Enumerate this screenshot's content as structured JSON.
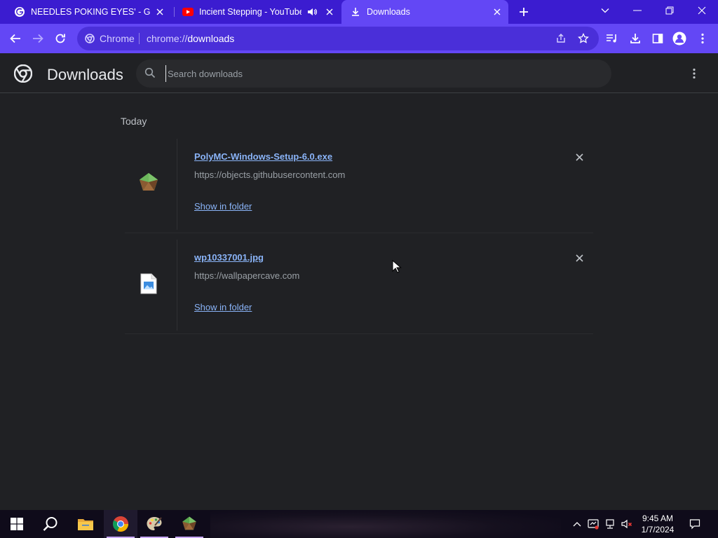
{
  "browser": {
    "tabs": [
      {
        "title": "NEEDLES POKING EYES' - Googl",
        "favicon": "google-icon"
      },
      {
        "title": "Incient Stepping - YouTube",
        "favicon": "youtube-icon",
        "audio": true
      },
      {
        "title": "Downloads",
        "favicon": "download-icon",
        "active": true
      }
    ],
    "omnibox": {
      "site_label": "Chrome",
      "url_scheme": "chrome://",
      "url_path": "downloads"
    }
  },
  "downloads": {
    "title": "Downloads",
    "search": {
      "placeholder": "Search downloads",
      "value": ""
    },
    "section_date": "Today",
    "items": [
      {
        "filename": "PolyMC-Windows-Setup-6.0.exe",
        "source": "https://objects.githubusercontent.com",
        "action": "Show in folder",
        "icon": "polymc-icon"
      },
      {
        "filename": "wp10337001.jpg",
        "source": "https://wallpapercave.com",
        "action": "Show in folder",
        "icon": "image-file-icon"
      }
    ]
  },
  "taskbar": {
    "time": "9:45 AM",
    "date": "1/7/2024"
  },
  "colors": {
    "tab_strip": "#3b1cd0",
    "toolbar": "#6347f5",
    "page_bg": "#202124",
    "link": "#8ab4f8"
  }
}
